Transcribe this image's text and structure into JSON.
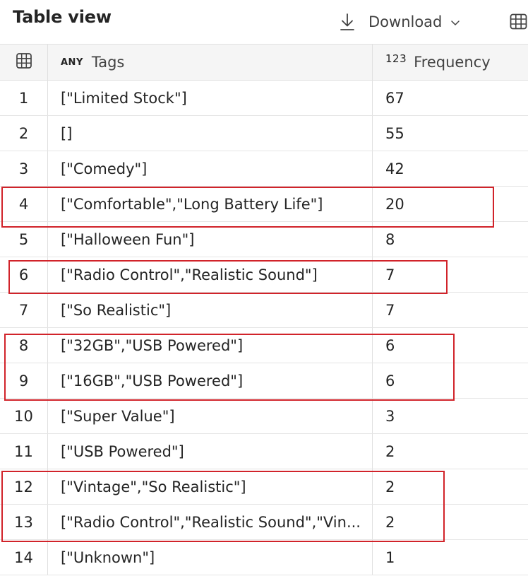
{
  "header": {
    "title": "Table view",
    "download_label": "Download"
  },
  "columns": {
    "tags": {
      "type_badge": "ANY",
      "label": "Tags"
    },
    "frequency": {
      "type_badge": "123",
      "label": "Frequency"
    }
  },
  "rows": [
    {
      "index": "1",
      "tags": "[\"Limited Stock\"]",
      "frequency": "67"
    },
    {
      "index": "2",
      "tags": "[]",
      "frequency": "55"
    },
    {
      "index": "3",
      "tags": "[\"Comedy\"]",
      "frequency": "42"
    },
    {
      "index": "4",
      "tags": "[\"Comfortable\",\"Long Battery Life\"]",
      "frequency": "20"
    },
    {
      "index": "5",
      "tags": "[\"Halloween Fun\"]",
      "frequency": "8"
    },
    {
      "index": "6",
      "tags": "[\"Radio Control\",\"Realistic Sound\"]",
      "frequency": "7"
    },
    {
      "index": "7",
      "tags": "[\"So Realistic\"]",
      "frequency": "7"
    },
    {
      "index": "8",
      "tags": "[\"32GB\",\"USB Powered\"]",
      "frequency": "6"
    },
    {
      "index": "9",
      "tags": "[\"16GB\",\"USB Powered\"]",
      "frequency": "6"
    },
    {
      "index": "10",
      "tags": "[\"Super Value\"]",
      "frequency": "3"
    },
    {
      "index": "11",
      "tags": "[\"USB Powered\"]",
      "frequency": "2"
    },
    {
      "index": "12",
      "tags": "[\"Vintage\",\"So Realistic\"]",
      "frequency": "2"
    },
    {
      "index": "13",
      "tags": "[\"Radio Control\",\"Realistic Sound\",\"Vin...",
      "frequency": "2"
    },
    {
      "index": "14",
      "tags": "[\"Unknown\"]",
      "frequency": "1"
    }
  ],
  "highlighted_row_groups": [
    [
      "4"
    ],
    [
      "6"
    ],
    [
      "8",
      "9"
    ],
    [
      "12",
      "13"
    ]
  ],
  "colors": {
    "highlight": "#d1232a",
    "header_bg": "#f5f5f5",
    "grid_line": "#e0e0e0"
  },
  "icons": [
    "download-arrow-icon",
    "chevron-down-icon",
    "table-grid-icon"
  ]
}
